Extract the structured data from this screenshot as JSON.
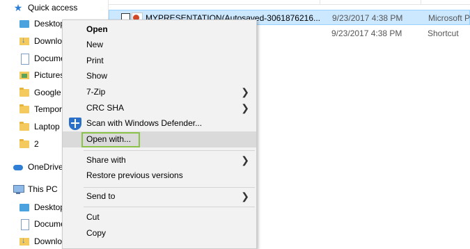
{
  "nav": {
    "quick_access": "Quick access",
    "items": [
      {
        "label": "Desktop",
        "icon": "desktop-folder-icon"
      },
      {
        "label": "Downloa",
        "icon": "downloads-folder-icon"
      },
      {
        "label": "Docume",
        "icon": "documents-folder-icon"
      },
      {
        "label": "Pictures",
        "icon": "pictures-folder-icon"
      },
      {
        "label": "Google D",
        "icon": "folder-icon"
      },
      {
        "label": "Tempora",
        "icon": "folder-icon"
      },
      {
        "label": "Laptop M",
        "icon": "folder-icon"
      },
      {
        "label": "2",
        "icon": "folder-icon"
      }
    ],
    "onedrive": "OneDrive",
    "this_pc": "This PC",
    "pc_items": [
      {
        "label": "Desktop",
        "icon": "desktop-folder-icon"
      },
      {
        "label": "Docume",
        "icon": "documents-folder-icon"
      },
      {
        "label": "Downlo",
        "icon": "downloads-folder-icon"
      }
    ]
  },
  "files": [
    {
      "name": "MYPRESENTATION(Autosaved-3061876216...",
      "date": "9/23/2017 4:38 PM",
      "type": "Microsoft P",
      "selected": true
    },
    {
      "name": "",
      "date": "9/23/2017 4:38 PM",
      "type": "Shortcut",
      "selected": false
    }
  ],
  "menu": {
    "open": "Open",
    "new": "New",
    "print": "Print",
    "show": "Show",
    "zip": "7-Zip",
    "crc": "CRC SHA",
    "defender": "Scan with Windows Defender...",
    "open_with": "Open with...",
    "share_with": "Share with",
    "restore": "Restore previous versions",
    "send_to": "Send to",
    "cut": "Cut",
    "copy": "Copy"
  },
  "colors": {
    "selection": "#cce8ff",
    "highlight_outline": "#8bc34a",
    "menu_bg": "#f2f2f2"
  }
}
